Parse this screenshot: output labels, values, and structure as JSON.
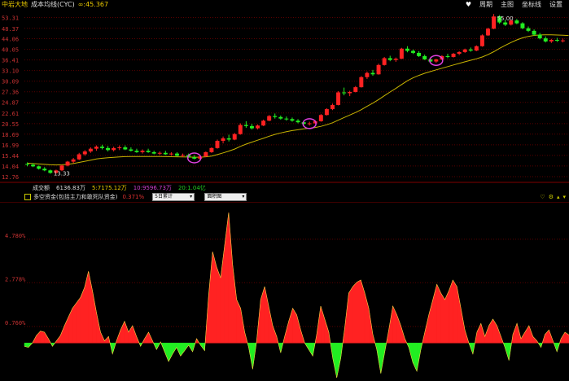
{
  "header": {
    "stock_name": "中岩大地",
    "indicator_name": "成本均线(CYC)",
    "cyc_label": "∞:45.367",
    "menu": [
      "周期",
      "主图",
      "坐标线",
      "设置"
    ],
    "heart_icon": "heart-icon"
  },
  "volume_row": {
    "label": "成交额",
    "total": "6136.83万",
    "v5": "5:7175.12万",
    "v10": "10:9596.73万",
    "v20": "20:1.04亿"
  },
  "indicator_row": {
    "title": "多空资金(包括主力和敢死队资金)",
    "value": "0.371%",
    "select1": "5日累计",
    "select2": "面积图"
  },
  "colors": {
    "up": "#ff2222",
    "down": "#22ee22",
    "ma": "#c8b400",
    "grid": "#5a0000",
    "axis_text": "#cc3333",
    "circle": "#e040e0"
  },
  "chart_data": [
    {
      "type": "candlestick",
      "y_ticks": [
        "53.31",
        "48.37",
        "44.06",
        "40.05",
        "36.41",
        "33.10",
        "30.09",
        "27.36",
        "24.87",
        "22.61",
        "20.55",
        "18.69",
        "16.99",
        "15.44",
        "14.04",
        "12.76"
      ],
      "ylim": [
        12.3,
        55.5
      ],
      "log_scale": true,
      "low_annotation": "13.33",
      "high_annotation": "55.00",
      "ohlc": [
        [
          14.3,
          14.5,
          14.0,
          14.2
        ],
        [
          14.2,
          14.4,
          13.9,
          14.0
        ],
        [
          14.0,
          14.1,
          13.6,
          13.7
        ],
        [
          13.7,
          13.9,
          13.4,
          13.5
        ],
        [
          13.5,
          13.6,
          13.1,
          13.2
        ],
        [
          13.2,
          13.6,
          13.1,
          13.5
        ],
        [
          13.5,
          14.2,
          13.4,
          14.1
        ],
        [
          14.1,
          14.7,
          14.0,
          14.6
        ],
        [
          14.6,
          15.1,
          14.4,
          14.9
        ],
        [
          14.9,
          15.8,
          14.8,
          15.6
        ],
        [
          15.6,
          16.2,
          15.4,
          16.0
        ],
        [
          16.0,
          16.6,
          15.8,
          16.4
        ],
        [
          16.4,
          16.9,
          16.1,
          16.7
        ],
        [
          16.7,
          17.0,
          16.3,
          16.5
        ],
        [
          16.5,
          16.8,
          16.0,
          16.2
        ],
        [
          16.2,
          16.7,
          16.0,
          16.5
        ],
        [
          16.5,
          16.9,
          16.2,
          16.6
        ],
        [
          16.6,
          16.9,
          16.2,
          16.3
        ],
        [
          16.3,
          16.6,
          16.0,
          16.1
        ],
        [
          16.1,
          16.4,
          15.8,
          15.9
        ],
        [
          15.9,
          16.3,
          15.7,
          16.1
        ],
        [
          16.1,
          16.4,
          15.8,
          15.9
        ],
        [
          15.9,
          16.1,
          15.6,
          15.7
        ],
        [
          15.7,
          16.0,
          15.5,
          15.8
        ],
        [
          15.8,
          16.1,
          15.5,
          15.6
        ],
        [
          15.6,
          15.9,
          15.4,
          15.7
        ],
        [
          15.7,
          15.9,
          15.3,
          15.4
        ],
        [
          15.4,
          15.7,
          15.2,
          15.5
        ],
        [
          15.5,
          15.7,
          15.1,
          15.2
        ],
        [
          15.2,
          15.5,
          14.9,
          15.0
        ],
        [
          15.0,
          15.4,
          14.9,
          15.3
        ],
        [
          15.3,
          16.0,
          15.2,
          15.9
        ],
        [
          15.9,
          16.6,
          15.8,
          16.5
        ],
        [
          16.5,
          17.8,
          16.4,
          17.6
        ],
        [
          17.6,
          18.3,
          17.2,
          18.0
        ],
        [
          18.0,
          18.6,
          17.5,
          17.8
        ],
        [
          17.8,
          18.9,
          17.7,
          18.7
        ],
        [
          18.7,
          20.6,
          18.6,
          20.3
        ],
        [
          20.3,
          21.0,
          19.8,
          20.1
        ],
        [
          20.1,
          20.5,
          19.5,
          19.7
        ],
        [
          19.7,
          20.4,
          19.5,
          20.2
        ],
        [
          20.2,
          21.3,
          20.1,
          21.1
        ],
        [
          21.1,
          22.2,
          21.0,
          22.0
        ],
        [
          22.0,
          22.5,
          21.5,
          21.8
        ],
        [
          21.8,
          22.1,
          21.3,
          21.5
        ],
        [
          21.5,
          21.9,
          21.1,
          21.4
        ],
        [
          21.4,
          21.7,
          20.9,
          21.1
        ],
        [
          21.1,
          21.4,
          20.6,
          20.8
        ],
        [
          20.8,
          21.1,
          20.3,
          20.5
        ],
        [
          20.5,
          20.9,
          20.2,
          20.6
        ],
        [
          20.6,
          21.2,
          20.5,
          21.0
        ],
        [
          21.0,
          22.4,
          20.9,
          22.2
        ],
        [
          22.2,
          23.6,
          22.1,
          23.4
        ],
        [
          23.4,
          24.6,
          23.2,
          24.3
        ],
        [
          24.3,
          27.5,
          24.2,
          27.2
        ],
        [
          27.2,
          28.4,
          26.5,
          27.0
        ],
        [
          27.0,
          27.6,
          26.3,
          27.3
        ],
        [
          27.3,
          28.8,
          27.2,
          28.5
        ],
        [
          28.5,
          31.5,
          28.4,
          31.2
        ],
        [
          31.2,
          32.8,
          30.7,
          32.4
        ],
        [
          32.4,
          33.3,
          31.6,
          32.0
        ],
        [
          32.0,
          35.2,
          31.9,
          34.8
        ],
        [
          34.8,
          37.4,
          34.6,
          37.0
        ],
        [
          37.0,
          37.8,
          36.0,
          36.4
        ],
        [
          36.4,
          37.2,
          35.8,
          36.8
        ],
        [
          36.8,
          40.6,
          36.7,
          40.3
        ],
        [
          40.3,
          41.2,
          39.0,
          39.5
        ],
        [
          39.5,
          40.0,
          38.4,
          38.8
        ],
        [
          38.8,
          39.4,
          37.4,
          37.7
        ],
        [
          37.7,
          38.2,
          36.4,
          36.6
        ],
        [
          36.6,
          37.1,
          35.7,
          35.9
        ],
        [
          35.9,
          36.8,
          35.5,
          36.6
        ],
        [
          36.6,
          38.0,
          36.3,
          37.7
        ],
        [
          37.7,
          38.5,
          37.0,
          37.4
        ],
        [
          37.4,
          38.8,
          37.2,
          38.5
        ],
        [
          38.5,
          39.4,
          38.0,
          39.1
        ],
        [
          39.1,
          40.3,
          38.8,
          40.0
        ],
        [
          40.0,
          40.7,
          39.2,
          39.6
        ],
        [
          39.6,
          41.5,
          39.4,
          41.2
        ],
        [
          41.2,
          45.8,
          41.0,
          45.4
        ],
        [
          45.4,
          48.6,
          45.2,
          48.2
        ],
        [
          48.2,
          55.0,
          48.0,
          53.8
        ],
        [
          53.8,
          54.5,
          50.4,
          51.0
        ],
        [
          51.0,
          52.0,
          49.4,
          50.0
        ],
        [
          50.0,
          52.4,
          49.6,
          51.9
        ],
        [
          51.9,
          52.6,
          50.2,
          50.6
        ],
        [
          50.6,
          51.1,
          48.0,
          48.4
        ],
        [
          48.4,
          49.2,
          46.8,
          47.3
        ],
        [
          47.3,
          47.9,
          45.2,
          45.7
        ],
        [
          45.7,
          46.4,
          43.8,
          44.2
        ],
        [
          44.2,
          45.0,
          42.6,
          43.0
        ],
        [
          43.0,
          44.0,
          42.4,
          43.6
        ],
        [
          43.6,
          44.4,
          42.8,
          43.3
        ],
        [
          43.3,
          44.1,
          42.6,
          43.4
        ]
      ],
      "ma": [
        14.4,
        14.35,
        14.3,
        14.25,
        14.2,
        14.18,
        14.2,
        14.25,
        14.35,
        14.5,
        14.65,
        14.8,
        14.95,
        15.05,
        15.12,
        15.18,
        15.23,
        15.27,
        15.3,
        15.3,
        15.3,
        15.3,
        15.29,
        15.28,
        15.27,
        15.26,
        15.25,
        15.24,
        15.22,
        15.2,
        15.2,
        15.25,
        15.35,
        15.55,
        15.8,
        16.05,
        16.35,
        16.75,
        17.1,
        17.4,
        17.7,
        18.0,
        18.35,
        18.65,
        18.9,
        19.1,
        19.3,
        19.45,
        19.6,
        19.7,
        19.85,
        20.05,
        20.35,
        20.7,
        21.2,
        21.7,
        22.2,
        22.7,
        23.3,
        24.0,
        24.7,
        25.5,
        26.4,
        27.3,
        28.2,
        29.2,
        30.2,
        31.0,
        31.7,
        32.3,
        32.8,
        33.3,
        33.8,
        34.3,
        34.8,
        35.3,
        35.8,
        36.3,
        36.8,
        37.4,
        38.2,
        39.2,
        40.4,
        41.5,
        42.6,
        43.6,
        44.4,
        45.0,
        45.4,
        45.6,
        45.65,
        45.62,
        45.55,
        45.45,
        45.37
      ],
      "markers": [
        29,
        49,
        71
      ]
    },
    {
      "type": "area",
      "y_ticks": [
        "4.780%",
        "2.778%",
        "0.760%"
      ],
      "ylim": [
        -1.6,
        6.2
      ],
      "values": [
        -0.15,
        -0.2,
        0.0,
        0.35,
        0.55,
        0.5,
        0.2,
        -0.15,
        0.1,
        0.35,
        0.8,
        1.2,
        1.6,
        1.85,
        2.1,
        2.55,
        3.3,
        2.4,
        1.4,
        0.5,
        0.1,
        0.3,
        -0.5,
        0.1,
        0.6,
        1.0,
        0.5,
        0.8,
        0.3,
        -0.15,
        0.2,
        0.5,
        0.1,
        -0.3,
        0.05,
        -0.4,
        -0.85,
        -0.5,
        -0.2,
        -0.6,
        -0.35,
        -0.1,
        -0.4,
        0.2,
        -0.1,
        -0.35,
        2.2,
        4.2,
        3.5,
        3.0,
        4.5,
        6.0,
        3.6,
        2.0,
        1.6,
        0.5,
        -0.2,
        -1.2,
        0.1,
        2.0,
        2.6,
        1.7,
        0.8,
        0.3,
        -0.45,
        0.3,
        1.0,
        1.6,
        1.3,
        0.6,
        0.0,
        -0.3,
        -0.6,
        0.4,
        1.7,
        1.1,
        0.5,
        -0.7,
        -1.6,
        -0.7,
        0.7,
        2.3,
        2.6,
        2.8,
        2.9,
        2.3,
        1.6,
        0.4,
        -0.3,
        -1.4,
        -0.4,
        0.6,
        1.7,
        1.3,
        0.8,
        0.2,
        -0.2,
        -0.9,
        -1.3,
        -0.3,
        0.5,
        1.3,
        2.0,
        2.7,
        2.3,
        2.0,
        2.4,
        2.9,
        2.6,
        1.6,
        0.6,
        0.0,
        -0.5,
        0.5,
        0.9,
        0.3,
        0.8,
        1.1,
        0.8,
        0.3,
        -0.2,
        -0.8,
        0.4,
        0.9,
        0.2,
        0.5,
        0.8,
        0.3,
        0.1,
        -0.2,
        0.4,
        0.6,
        0.1,
        -0.4,
        0.2,
        0.5,
        0.37
      ]
    }
  ]
}
